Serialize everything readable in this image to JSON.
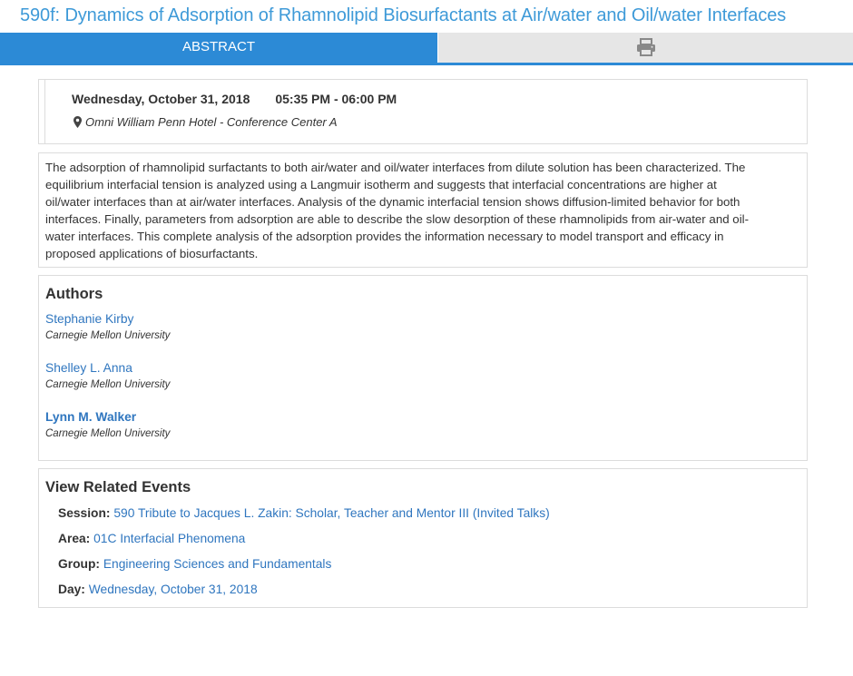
{
  "page": {
    "title": "590f: Dynamics of Adsorption of Rhamnolipid Biosurfactants at Air/water and Oil/water Interfaces"
  },
  "tabs": {
    "abstract_label": "ABSTRACT",
    "print_icon": "printer-icon"
  },
  "event": {
    "date": "Wednesday, October 31, 2018",
    "time": "05:35 PM - 06:00 PM",
    "location_icon": "map-marker-icon",
    "location": "Omni William Penn Hotel - Conference Center A"
  },
  "abstract": {
    "lines": [
      "The adsorption of rhamnolipid surfactants to both air/water and oil/water interfaces from dilute solution has been characterized. The",
      "equilibrium interfacial tension is analyzed using a Langmuir isotherm and suggests that interfacial concentrations are higher at",
      "oil/water interfaces than at air/water interfaces. Analysis of the dynamic interfacial tension shows diffusion-limited behavior for both",
      "interfaces. Finally, parameters from adsorption are able to describe the slow desorption of these rhamnolipids from air-water and oil-",
      "water interfaces. This complete analysis of the adsorption provides the information necessary to model transport and efficacy in",
      "proposed applications of biosurfactants."
    ]
  },
  "authors": {
    "heading": "Authors",
    "list": [
      {
        "name": "Stephanie Kirby",
        "affiliation": "Carnegie Mellon University"
      },
      {
        "name": "Shelley L. Anna",
        "affiliation": "Carnegie Mellon University"
      },
      {
        "name": "Lynn M. Walker",
        "affiliation": "Carnegie Mellon University"
      }
    ]
  },
  "related": {
    "heading": "View Related Events",
    "session_label": "Session:",
    "session_value": "590 Tribute to Jacques L. Zakin: Scholar, Teacher and Mentor III (Invited Talks)",
    "area_label": "Area:",
    "area_value": "01C Interfacial Phenomena",
    "group_label": "Group:",
    "group_value": "Engineering Sciences and Fundamentals",
    "day_label": "Day:",
    "day_value": "Wednesday, October 31, 2018"
  },
  "colors": {
    "accent": "#2c8ad6",
    "title": "#3e9ad8",
    "link": "#2f76bf",
    "tab_inactive": "#e6e6e6"
  }
}
